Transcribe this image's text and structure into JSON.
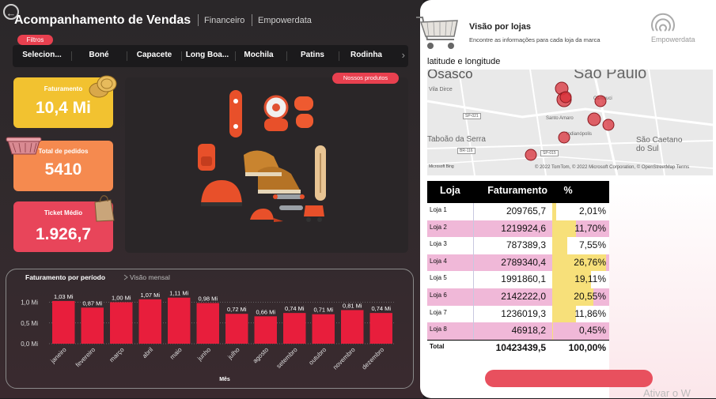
{
  "header": {
    "title": "Acompanhamento de Vendas",
    "nav": [
      "Financeiro",
      "Empowerdata"
    ]
  },
  "filters": {
    "label": "Filtros",
    "chips": [
      "Selecion...",
      "Boné",
      "Capacete",
      "Long Boa...",
      "Mochila",
      "Patins",
      "Rodinha"
    ]
  },
  "kpis": [
    {
      "label": "Faturamento",
      "value": "10,4 Mi",
      "color": "#f2c230",
      "icon": "coins-icon"
    },
    {
      "label": "Total de pedidos",
      "value": "5410",
      "color": "#f58a4f",
      "icon": "basket-icon"
    },
    {
      "label": "Ticket Médio",
      "value": "1.926,7",
      "color": "#e8455a",
      "icon": "shopping-bag-icon"
    }
  ],
  "products": {
    "badge": "Nossos produtos"
  },
  "chart_data": {
    "type": "bar",
    "title": "Faturamento por período",
    "subtitle": "Visão mensal",
    "xlabel": "Mês",
    "ylabel": "",
    "categories": [
      "janeiro",
      "fevereiro",
      "março",
      "abril",
      "maio",
      "junho",
      "julho",
      "agosto",
      "setembro",
      "outubro",
      "novembro",
      "dezembro"
    ],
    "values": [
      1.03,
      0.87,
      1.0,
      1.07,
      1.11,
      0.98,
      0.72,
      0.66,
      0.74,
      0.71,
      0.81,
      0.74
    ],
    "data_labels": [
      "1,03 Mi",
      "0,87 Mi",
      "1,00 Mi",
      "1,07 Mi",
      "1,11 Mi",
      "0,98 Mi",
      "0,72 Mi",
      "0,66 Mi",
      "0,74 Mi",
      "0,71 Mi",
      "0,81 Mi",
      "0,74 Mi"
    ],
    "yticks": [
      "0,0 Mi",
      "0,5 Mi",
      "1,0 Mi"
    ],
    "ylim": [
      0,
      1.2
    ],
    "color": "#e81e3c",
    "grid": true
  },
  "stores_panel": {
    "title": "Visão por lojas",
    "subtitle": "Encontre as informações para cada loja da marca",
    "brand": "Empowerdata",
    "map_label": "latitude e longitude",
    "map_places": [
      "Osasco",
      "São Paulo",
      "São Caetano do Sul",
      "Taboão da Serra",
      "Vila Dirce",
      "Cambuci",
      "Indianópolis",
      "Santo Amaro",
      "SP-021",
      "SP-015",
      "BR-116"
    ],
    "map_attribution": "© 2022 TomTom, © 2022 Microsoft Corporation, © OpenStreetMap  Terms",
    "map_provider": "Microsoft Bing"
  },
  "table": {
    "headers": [
      "Loja",
      "Faturamento",
      "%"
    ],
    "rows": [
      {
        "loja": "Loja 1",
        "fat": "209765,7",
        "pct": "2,01%",
        "share": 0.0201
      },
      {
        "loja": "Loja 2",
        "fat": "1219924,6",
        "pct": "11,70%",
        "share": 0.117
      },
      {
        "loja": "Loja 3",
        "fat": "787389,3",
        "pct": "7,55%",
        "share": 0.0755
      },
      {
        "loja": "Loja 4",
        "fat": "2789340,4",
        "pct": "26,76%",
        "share": 0.2676
      },
      {
        "loja": "Loja 5",
        "fat": "1991860,1",
        "pct": "19,11%",
        "share": 0.1911
      },
      {
        "loja": "Loja 6",
        "fat": "2142222,0",
        "pct": "20,55%",
        "share": 0.2055
      },
      {
        "loja": "Loja 7",
        "fat": "1236019,3",
        "pct": "11,86%",
        "share": 0.1186
      },
      {
        "loja": "Loja 8",
        "fat": "46918,2",
        "pct": "0,45%",
        "share": 0.0045
      }
    ],
    "total": {
      "loja": "Total",
      "fat": "10423439,5",
      "pct": "100,00%"
    }
  },
  "watermark": "Ativar o W"
}
